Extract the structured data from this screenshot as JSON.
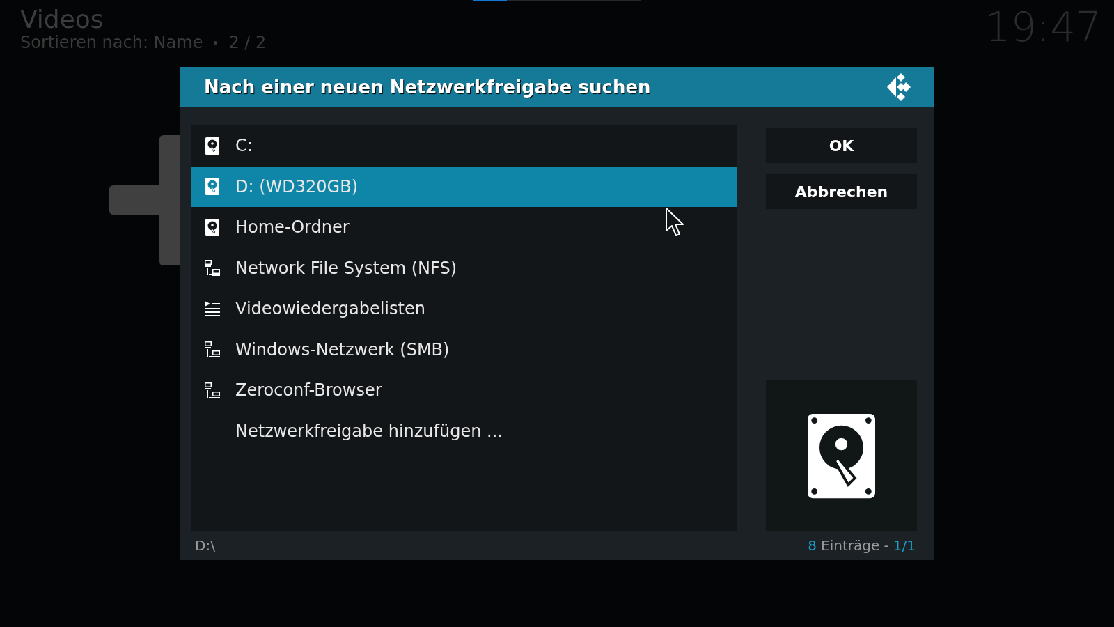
{
  "header": {
    "title": "Videos",
    "subtitle": "Sortieren nach: Name",
    "page": "2 / 2",
    "clock": "19:47",
    "progress": {
      "level": 0.2
    }
  },
  "dialog": {
    "title": "Nach einer neuen Netzwerkfreigabe suchen",
    "items": [
      {
        "label": "C:",
        "kind": "drive",
        "selected": false
      },
      {
        "label": "D: (WD320GB)",
        "kind": "drive",
        "selected": true
      },
      {
        "label": "Home-Ordner",
        "kind": "drive",
        "selected": false
      },
      {
        "label": "Network File System (NFS)",
        "kind": "network",
        "selected": false
      },
      {
        "label": "Videowiedergabelisten",
        "kind": "playlist",
        "selected": false
      },
      {
        "label": "Windows-Netzwerk (SMB)",
        "kind": "network",
        "selected": false
      },
      {
        "label": "Zeroconf-Browser",
        "kind": "network",
        "selected": false
      },
      {
        "label": "Netzwerkfreigabe hinzufügen ...",
        "kind": "plain",
        "selected": false
      }
    ],
    "buttons": [
      "OK",
      "Abbrechen"
    ],
    "path": "D:\\",
    "count": "8",
    "count_label": "Einträge -",
    "pages": "1/1"
  }
}
